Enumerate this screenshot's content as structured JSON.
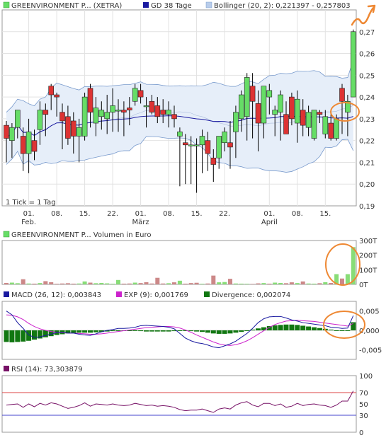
{
  "colors": {
    "up": "#66dd66",
    "down": "#dd3333",
    "band": "#e6eef9",
    "band_line": "#7799cc",
    "ma": "#1a1aa0",
    "macd": "#1a1aa0",
    "exp": "#cc22cc",
    "div": "#117711",
    "rsi": "#771166",
    "rsi_hi": "#dd4444",
    "rsi_lo": "#4444cc",
    "vol_up": "#88dd77",
    "vol_down": "#cc8888",
    "annot": "#ee8833"
  },
  "legend": {
    "price": "GREENVIRONMENT P... (XETRA)",
    "ma": "GD 38 Tage",
    "bollinger": "Bollinger (20, 2): 0,221397 - 0,257803",
    "volume": "GREENVIRONMENT P... Volumen in Euro",
    "macd": "MACD (26, 12): 0,003843",
    "exp": "EXP (9): 0,001769",
    "divergence": "Divergence: 0,002074",
    "rsi": "RSI (14): 73,303879"
  },
  "tick_note": "1 Tick = 1 Tag",
  "chart_data": [
    {
      "type": "candlestick",
      "ylim": [
        0.19,
        0.28
      ],
      "y_ticks": [
        "0,19",
        "0,20",
        "0,21",
        "0,22",
        "0,23",
        "0,24",
        "0,25",
        "0,26",
        "0,27"
      ],
      "y_tick_values": [
        0.19,
        0.2,
        0.21,
        0.22,
        0.23,
        0.24,
        0.25,
        0.26,
        0.27
      ],
      "x_tick_labels": [
        {
          "i": 4,
          "text": "01.",
          "sub": "Feb."
        },
        {
          "i": 9,
          "text": "08.",
          "sub": ""
        },
        {
          "i": 14,
          "text": "15.",
          "sub": ""
        },
        {
          "i": 19,
          "text": "22.",
          "sub": ""
        },
        {
          "i": 24,
          "text": "01.",
          "sub": "März"
        },
        {
          "i": 29,
          "text": "08.",
          "sub": ""
        },
        {
          "i": 34,
          "text": "15.",
          "sub": ""
        },
        {
          "i": 39,
          "text": "22.",
          "sub": ""
        },
        {
          "i": 47,
          "text": "01.",
          "sub": "April"
        },
        {
          "i": 52,
          "text": "08.",
          "sub": ""
        },
        {
          "i": 57,
          "text": "15.",
          "sub": ""
        }
      ],
      "candles": [
        {
          "o": 0.227,
          "h": 0.229,
          "l": 0.21,
          "c": 0.221
        },
        {
          "o": 0.22,
          "h": 0.228,
          "l": 0.212,
          "c": 0.226
        },
        {
          "o": 0.226,
          "h": 0.234,
          "l": 0.221,
          "c": 0.234
        },
        {
          "o": 0.222,
          "h": 0.226,
          "l": 0.206,
          "c": 0.214
        },
        {
          "o": 0.214,
          "h": 0.23,
          "l": 0.205,
          "c": 0.224
        },
        {
          "o": 0.22,
          "h": 0.225,
          "l": 0.211,
          "c": 0.215
        },
        {
          "o": 0.225,
          "h": 0.238,
          "l": 0.218,
          "c": 0.234
        },
        {
          "o": 0.234,
          "h": 0.237,
          "l": 0.222,
          "c": 0.232
        },
        {
          "o": 0.245,
          "h": 0.246,
          "l": 0.234,
          "c": 0.241
        },
        {
          "o": 0.241,
          "h": 0.242,
          "l": 0.231,
          "c": 0.24
        },
        {
          "o": 0.233,
          "h": 0.237,
          "l": 0.216,
          "c": 0.229
        },
        {
          "o": 0.231,
          "h": 0.236,
          "l": 0.218,
          "c": 0.221
        },
        {
          "o": 0.229,
          "h": 0.233,
          "l": 0.214,
          "c": 0.222
        },
        {
          "o": 0.222,
          "h": 0.23,
          "l": 0.21,
          "c": 0.226
        },
        {
          "o": 0.222,
          "h": 0.242,
          "l": 0.22,
          "c": 0.24
        },
        {
          "o": 0.244,
          "h": 0.246,
          "l": 0.226,
          "c": 0.233
        },
        {
          "o": 0.228,
          "h": 0.24,
          "l": 0.222,
          "c": 0.235
        },
        {
          "o": 0.231,
          "h": 0.238,
          "l": 0.225,
          "c": 0.234
        },
        {
          "o": 0.23,
          "h": 0.241,
          "l": 0.223,
          "c": 0.233
        },
        {
          "o": 0.233,
          "h": 0.244,
          "l": 0.224,
          "c": 0.236
        },
        {
          "o": 0.234,
          "h": 0.239,
          "l": 0.224,
          "c": 0.234
        },
        {
          "o": 0.234,
          "h": 0.238,
          "l": 0.222,
          "c": 0.233
        },
        {
          "o": 0.235,
          "h": 0.24,
          "l": 0.227,
          "c": 0.234
        },
        {
          "o": 0.238,
          "h": 0.246,
          "l": 0.236,
          "c": 0.244
        },
        {
          "o": 0.243,
          "h": 0.246,
          "l": 0.237,
          "c": 0.24
        },
        {
          "o": 0.236,
          "h": 0.24,
          "l": 0.226,
          "c": 0.236
        },
        {
          "o": 0.238,
          "h": 0.241,
          "l": 0.232,
          "c": 0.233
        },
        {
          "o": 0.236,
          "h": 0.24,
          "l": 0.228,
          "c": 0.231
        },
        {
          "o": 0.234,
          "h": 0.239,
          "l": 0.228,
          "c": 0.232
        },
        {
          "o": 0.232,
          "h": 0.238,
          "l": 0.226,
          "c": 0.234
        },
        {
          "o": 0.232,
          "h": 0.236,
          "l": 0.226,
          "c": 0.23
        },
        {
          "o": 0.222,
          "h": 0.226,
          "l": 0.199,
          "c": 0.224
        },
        {
          "o": 0.219,
          "h": 0.223,
          "l": 0.2,
          "c": 0.218
        },
        {
          "o": 0.218,
          "h": 0.222,
          "l": 0.2,
          "c": 0.218
        },
        {
          "o": 0.218,
          "h": 0.221,
          "l": 0.196,
          "c": 0.218
        },
        {
          "o": 0.218,
          "h": 0.225,
          "l": 0.205,
          "c": 0.222
        },
        {
          "o": 0.22,
          "h": 0.224,
          "l": 0.206,
          "c": 0.214
        },
        {
          "o": 0.212,
          "h": 0.216,
          "l": 0.201,
          "c": 0.209
        },
        {
          "o": 0.212,
          "h": 0.222,
          "l": 0.207,
          "c": 0.222
        },
        {
          "o": 0.219,
          "h": 0.226,
          "l": 0.215,
          "c": 0.224
        },
        {
          "o": 0.219,
          "h": 0.229,
          "l": 0.207,
          "c": 0.217
        },
        {
          "o": 0.224,
          "h": 0.236,
          "l": 0.212,
          "c": 0.233
        },
        {
          "o": 0.23,
          "h": 0.243,
          "l": 0.224,
          "c": 0.241
        },
        {
          "o": 0.231,
          "h": 0.251,
          "l": 0.22,
          "c": 0.249
        },
        {
          "o": 0.245,
          "h": 0.251,
          "l": 0.221,
          "c": 0.238
        },
        {
          "o": 0.237,
          "h": 0.243,
          "l": 0.215,
          "c": 0.228
        },
        {
          "o": 0.228,
          "h": 0.244,
          "l": 0.221,
          "c": 0.245
        },
        {
          "o": 0.24,
          "h": 0.246,
          "l": 0.232,
          "c": 0.243
        },
        {
          "o": 0.232,
          "h": 0.236,
          "l": 0.222,
          "c": 0.234
        },
        {
          "o": 0.233,
          "h": 0.243,
          "l": 0.22,
          "c": 0.241
        },
        {
          "o": 0.232,
          "h": 0.238,
          "l": 0.226,
          "c": 0.223
        },
        {
          "o": 0.24,
          "h": 0.242,
          "l": 0.227,
          "c": 0.23
        },
        {
          "o": 0.228,
          "h": 0.243,
          "l": 0.219,
          "c": 0.239
        },
        {
          "o": 0.234,
          "h": 0.239,
          "l": 0.222,
          "c": 0.227
        },
        {
          "o": 0.226,
          "h": 0.236,
          "l": 0.222,
          "c": 0.233
        },
        {
          "o": 0.221,
          "h": 0.234,
          "l": 0.22,
          "c": 0.234
        },
        {
          "o": 0.233,
          "h": 0.234,
          "l": 0.228,
          "c": 0.232
        },
        {
          "o": 0.223,
          "h": 0.234,
          "l": 0.221,
          "c": 0.231
        },
        {
          "o": 0.228,
          "h": 0.232,
          "l": 0.22,
          "c": 0.221
        },
        {
          "o": 0.221,
          "h": 0.232,
          "l": 0.22,
          "c": 0.23
        },
        {
          "o": 0.244,
          "h": 0.246,
          "l": 0.223,
          "c": 0.238
        },
        {
          "o": 0.233,
          "h": 0.241,
          "l": 0.222,
          "c": 0.238
        },
        {
          "o": 0.24,
          "h": 0.271,
          "l": 0.24,
          "c": 0.27
        }
      ]
    },
    {
      "type": "bar",
      "title": "Volumen in Euro",
      "ylim": [
        0,
        300000
      ],
      "y_ticks": [
        "0T",
        "100T",
        "200T",
        "300T"
      ],
      "y_tick_values": [
        0,
        100000,
        200000,
        300000
      ],
      "values": [
        10000,
        12000,
        8000,
        35000,
        6000,
        5000,
        9000,
        22000,
        15000,
        4000,
        6000,
        8000,
        5000,
        6000,
        20000,
        12000,
        8000,
        10000,
        7000,
        4000,
        30000,
        5000,
        6000,
        12000,
        9000,
        15000,
        6000,
        45000,
        6000,
        8000,
        14000,
        25000,
        5000,
        9000,
        11000,
        4000,
        6000,
        60000,
        14000,
        16000,
        38000,
        6000,
        5000,
        4000,
        3000,
        7000,
        9000,
        5000,
        12000,
        10000,
        8000,
        14000,
        9000,
        20000,
        6000,
        5000,
        8000,
        15000,
        10000,
        70000,
        40000,
        70000,
        255000
      ],
      "up": [
        0,
        1,
        1,
        0,
        1,
        0,
        1,
        0,
        0,
        0,
        0,
        0,
        0,
        1,
        1,
        0,
        1,
        1,
        1,
        1,
        1,
        0,
        0,
        1,
        0,
        0,
        0,
        0,
        0,
        1,
        0,
        1,
        0,
        0,
        0,
        1,
        0,
        0,
        1,
        1,
        0,
        1,
        1,
        1,
        0,
        0,
        1,
        0,
        1,
        1,
        0,
        0,
        1,
        0,
        1,
        1,
        0,
        1,
        0,
        1,
        0,
        1,
        1
      ]
    },
    {
      "type": "line",
      "title": "MACD",
      "ylim": [
        -0.0075,
        0.0075
      ],
      "y_ticks": [
        "0,005",
        "0,000",
        "-0,005"
      ],
      "y_tick_values": [
        0.005,
        0.0,
        -0.005
      ],
      "series": [
        {
          "name": "MACD (26, 12)",
          "values": [
            0.005,
            0.004,
            0.002,
            0.0005,
            -0.0012,
            -0.0018,
            -0.0017,
            -0.0013,
            -0.001,
            -0.0005,
            -0.0005,
            -0.0007,
            -0.0007,
            -0.001,
            -0.0012,
            -0.0013,
            -0.0009,
            -0.0004,
            0.0,
            0.0002,
            0.0005,
            0.0005,
            0.0006,
            0.0008,
            0.0012,
            0.0013,
            0.0012,
            0.0011,
            0.001,
            0.0008,
            0.0004,
            -0.0008,
            -0.002,
            -0.0027,
            -0.0032,
            -0.0034,
            -0.0038,
            -0.0043,
            -0.0045,
            -0.004,
            -0.0035,
            -0.0028,
            -0.0018,
            -0.0008,
            0.0005,
            0.002,
            0.003,
            0.0035,
            0.0036,
            0.0036,
            0.0032,
            0.0027,
            0.0024,
            0.002,
            0.0018,
            0.0016,
            0.0014,
            0.0012,
            0.0008,
            0.0007,
            0.0005,
            0.0006,
            0.0038
          ]
        },
        {
          "name": "EXP (9)",
          "values": [
            0.004,
            0.0039,
            0.0035,
            0.0028,
            0.0018,
            0.001,
            0.0004,
            0.0,
            -0.0003,
            -0.0005,
            -0.0006,
            -0.0007,
            -0.0007,
            -0.0008,
            -0.0009,
            -0.001,
            -0.001,
            -0.0009,
            -0.0007,
            -0.0005,
            -0.0003,
            -0.0001,
            0.0001,
            0.0003,
            0.0005,
            0.0007,
            0.0008,
            0.0009,
            0.001,
            0.001,
            0.0009,
            0.0006,
            0.0001,
            -0.0005,
            -0.0012,
            -0.0018,
            -0.0024,
            -0.003,
            -0.0035,
            -0.0038,
            -0.0039,
            -0.0037,
            -0.0033,
            -0.0027,
            -0.0019,
            -0.001,
            -0.0001,
            0.0008,
            0.0015,
            0.002,
            0.0024,
            0.0025,
            0.0026,
            0.0025,
            0.0024,
            0.0023,
            0.0021,
            0.0019,
            0.0017,
            0.0015,
            0.0013,
            0.0011,
            0.0018
          ]
        },
        {
          "name": "Divergence",
          "values": [
            -0.003,
            -0.0031,
            -0.003,
            -0.0029,
            -0.0027,
            -0.0024,
            -0.0021,
            -0.0018,
            -0.0015,
            -0.0012,
            -0.001,
            -0.0008,
            -0.0007,
            -0.0006,
            -0.0006,
            -0.0006,
            -0.0005,
            -0.0004,
            -0.0003,
            -0.0002,
            -0.0002,
            -0.0001,
            -0.0001,
            -0.0001,
            -0.0002,
            -0.0003,
            -0.0003,
            -0.0003,
            -0.0003,
            -0.0003,
            -0.0002,
            -0.0001,
            -0.0001,
            -0.0002,
            -0.0003,
            -0.0004,
            -0.0006,
            -0.0008,
            -0.0009,
            -0.0009,
            -0.0008,
            -0.0006,
            -0.0004,
            -0.0001,
            0.0002,
            0.0005,
            0.0008,
            0.0011,
            0.0013,
            0.0014,
            0.0015,
            0.0015,
            0.0014,
            0.0012,
            0.001,
            0.0008,
            0.0006,
            0.0004,
            0.0002,
            -0.0001,
            -0.0001,
            0.0,
            0.0021
          ]
        }
      ]
    },
    {
      "type": "line",
      "title": "RSI",
      "ylim": [
        0,
        100
      ],
      "y_ticks": [
        "0",
        "30",
        "50",
        "70",
        "100"
      ],
      "y_tick_values": [
        0,
        30,
        50,
        70,
        100
      ],
      "hlines": [
        70,
        30
      ],
      "values": [
        48,
        49,
        50,
        44,
        50,
        45,
        51,
        48,
        52,
        50,
        46,
        42,
        44,
        47,
        52,
        46,
        50,
        49,
        48,
        50,
        48,
        47,
        48,
        51,
        49,
        47,
        48,
        46,
        47,
        46,
        44,
        40,
        38,
        39,
        39,
        41,
        38,
        35,
        41,
        43,
        41,
        48,
        52,
        54,
        48,
        45,
        51,
        51,
        47,
        50,
        44,
        46,
        51,
        47,
        49,
        50,
        48,
        47,
        44,
        48,
        55,
        55,
        73
      ]
    }
  ]
}
